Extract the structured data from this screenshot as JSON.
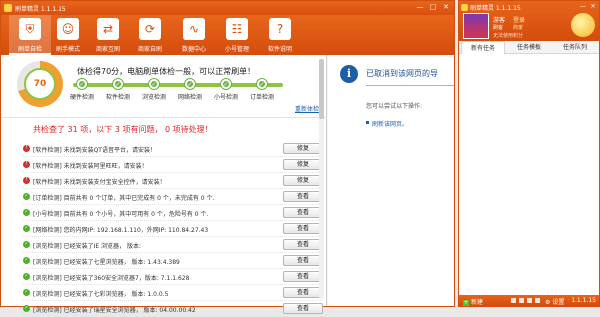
{
  "window": {
    "title": "刷单精灵 1.1.1.15",
    "min": "—",
    "max": "□",
    "close": "✕"
  },
  "toolbar": [
    {
      "label": "刷单自检",
      "icon": "shield-icon",
      "glyph": "⛨"
    },
    {
      "label": "刷手模式",
      "icon": "user-icon",
      "glyph": "☺"
    },
    {
      "label": "商家互刷",
      "icon": "handshake-icon",
      "glyph": "⇄"
    },
    {
      "label": "商家自刷",
      "icon": "refresh-icon",
      "glyph": "⟳"
    },
    {
      "label": "数据中心",
      "icon": "chart-icon",
      "glyph": "∿"
    },
    {
      "label": "小号管理",
      "icon": "users-icon",
      "glyph": "☷"
    },
    {
      "label": "软件说明",
      "icon": "help-icon",
      "glyph": "?"
    }
  ],
  "score": {
    "value": "70",
    "value_fraction": 0.7,
    "text": "体检得70分，电脑刷单体检一般，可以正常刷单！",
    "recheck": "重新体检"
  },
  "steps": [
    {
      "label": "硬件检测"
    },
    {
      "label": "软件检测"
    },
    {
      "label": "浏览检测"
    },
    {
      "label": "网络检测"
    },
    {
      "label": "小号检测"
    },
    {
      "label": "订单检测"
    }
  ],
  "summary": "共检查了 31 项，以下 3 项有问题， 0 项待处理！",
  "results": [
    {
      "status": "error",
      "text": "[软件检测] 未找到安装QT语音平台，请安装！",
      "button": "修复"
    },
    {
      "status": "error",
      "text": "[软件检测] 未找到安装阿里旺旺，请安装！",
      "button": "修复"
    },
    {
      "status": "error",
      "text": "[软件检测] 未找到安装支付宝安全控件，请安装！",
      "button": "修复"
    },
    {
      "status": "ok",
      "text": "[订单检测] 目前共有 0 个订单，其中已完成有 0 个，未完成有 0 个.",
      "button": "查看"
    },
    {
      "status": "ok",
      "text": "[小号检测] 目前共有 0 个小号，其中可用有 0 个，危险号有 0 个.",
      "button": "查看"
    },
    {
      "status": "ok",
      "text": "[网络检测] 您的内网IP: 192.168.1.110，外网IP: 110.84.27.43",
      "button": "查看"
    },
    {
      "status": "ok",
      "text": "[浏览检测] 已经安装了IE 浏览器， 版本:",
      "button": "查看"
    },
    {
      "status": "ok",
      "text": "[浏览检测] 已经安装了七星浏览器， 版本: 1.43.4.389",
      "button": "查看"
    },
    {
      "status": "ok",
      "text": "[浏览检测] 已经安装了360安全浏览器7，版本: 7.1.1.628",
      "button": "查看"
    },
    {
      "status": "ok",
      "text": "[浏览检测] 已经安装了七彩浏览器， 版本: 1.0.0.5",
      "button": "查看"
    },
    {
      "status": "ok",
      "text": "[浏览检测] 已经安装了瑞星安全浏览器， 版本: 04.00.00.42",
      "button": "查看"
    }
  ],
  "error_page": {
    "title": "已取消到该网页的导",
    "hint": "您可以尝试以下操作:",
    "link": "刷新该网页。"
  },
  "mini": {
    "title": "刷单精灵 1.1.1.15",
    "username": "游客",
    "login": "登录",
    "sub1": "刷客",
    "sub2": "商家",
    "sub3": "无法使用积分",
    "tabs": [
      {
        "label": "新有任务"
      },
      {
        "label": "任务模板"
      },
      {
        "label": "任务队列"
      }
    ],
    "footer": {
      "new": "新建",
      "settings": "设置",
      "version": "1.1.1.15"
    }
  },
  "colors": {
    "accent": "#d9500f",
    "ok": "#4caf2a",
    "error": "#d0302a",
    "link": "#1a5fb4"
  }
}
